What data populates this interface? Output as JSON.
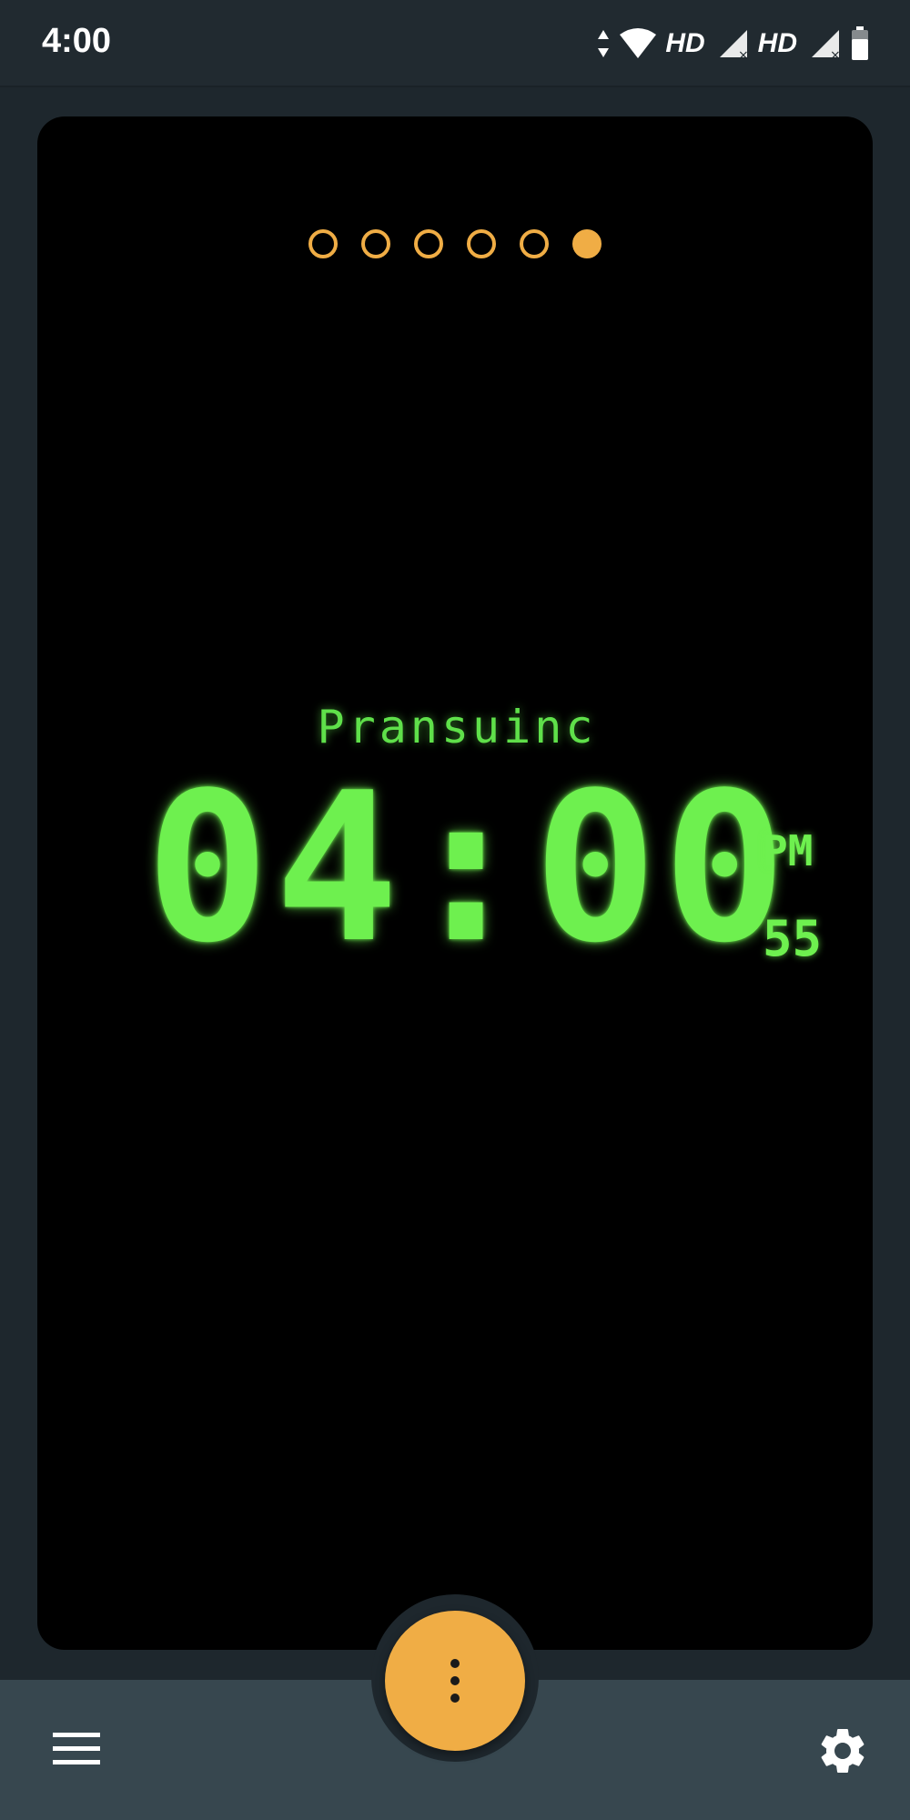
{
  "status_bar": {
    "time": "4:00",
    "network_label_1": "HD",
    "network_label_2": "HD"
  },
  "pager": {
    "total": 6,
    "active_index": 5
  },
  "clock": {
    "brand": "Pransuinc",
    "time": "04:00",
    "ampm": "PM",
    "seconds": "55"
  },
  "colors": {
    "accent": "#f0ad45",
    "clock_green": "#6ef04f",
    "background": "#1e272d",
    "bottom_bar": "#37474f"
  },
  "icons": {
    "fab": "more-vertical-icon",
    "left": "menu-icon",
    "right": "gear-icon"
  }
}
